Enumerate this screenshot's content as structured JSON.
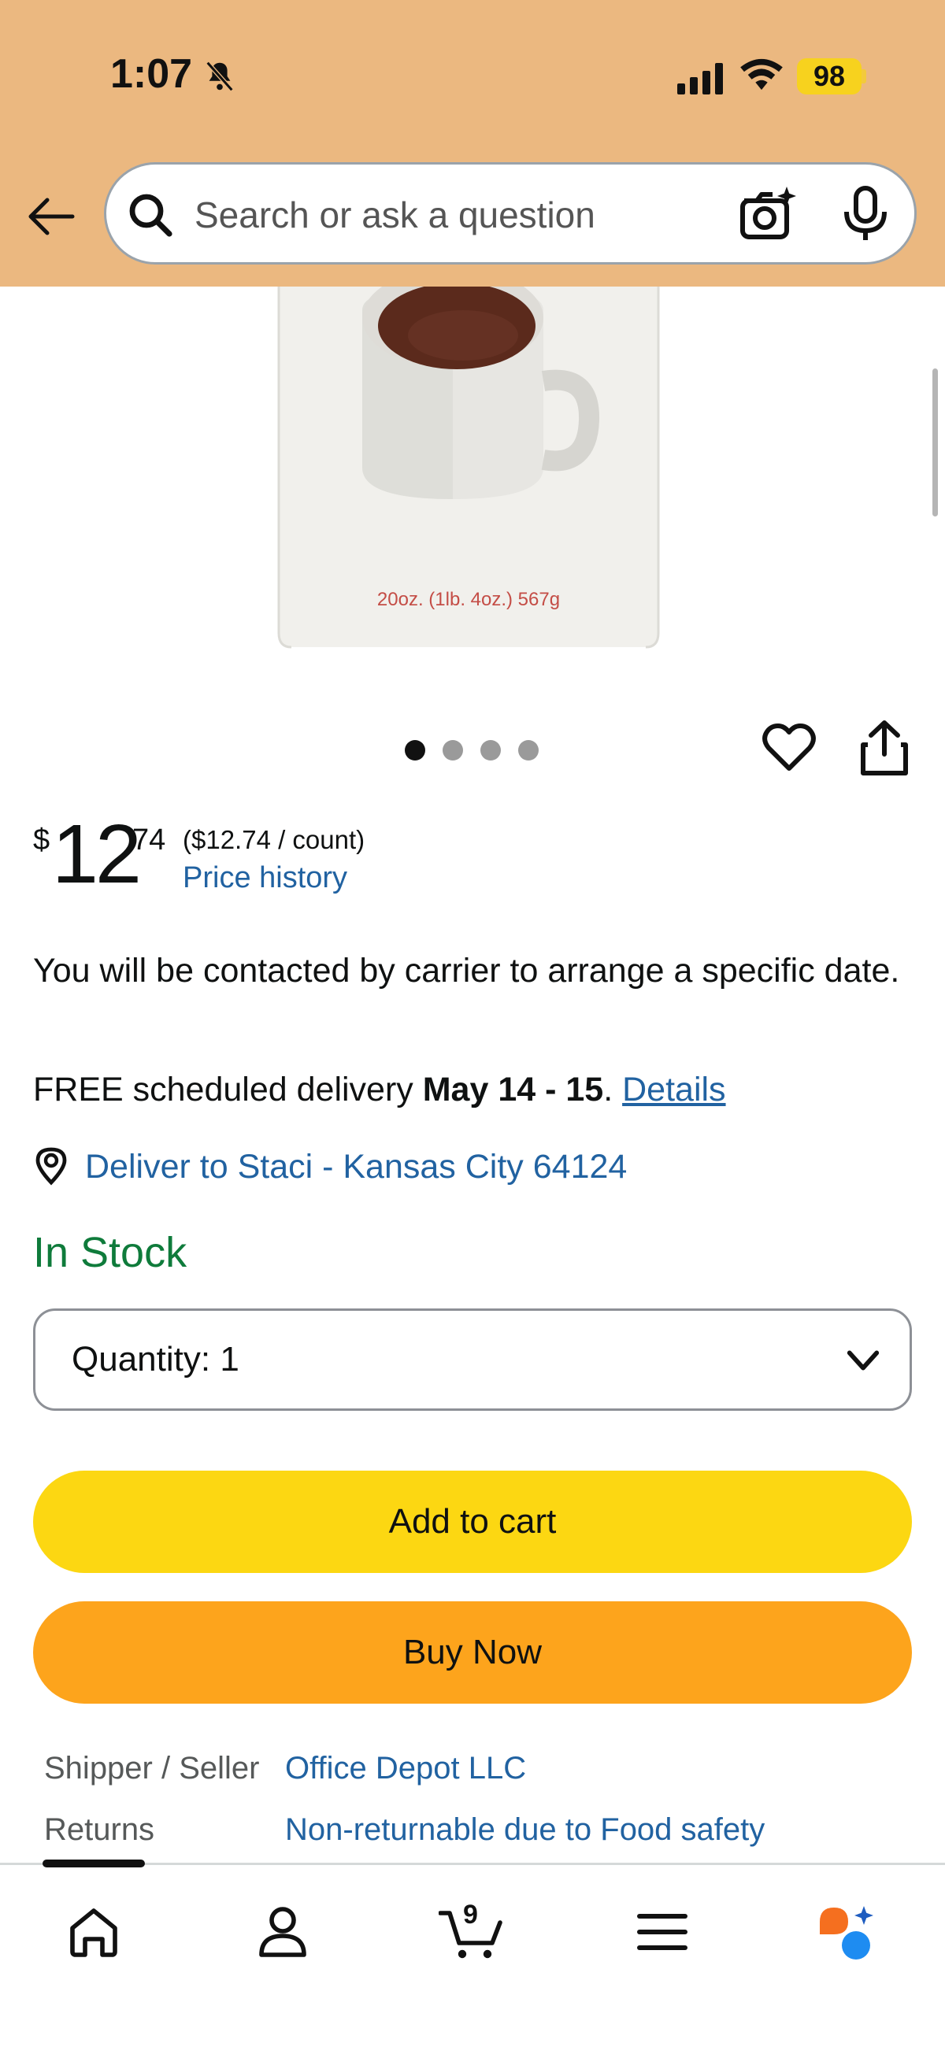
{
  "status_bar": {
    "time": "1:07",
    "battery": "98"
  },
  "search": {
    "placeholder": "Search or ask a question"
  },
  "product": {
    "image_label": "20oz. (1lb. 4oz.) 567g",
    "image_count": 4,
    "active_image_index": 0
  },
  "price": {
    "symbol": "$",
    "whole": "12",
    "fraction": "74",
    "unit_price": "($12.74 / count)",
    "history_link": "Price history"
  },
  "delivery": {
    "carrier_note": "You will be contacted by carrier to arrange a specific date.",
    "prefix": "FREE scheduled delivery ",
    "dates": "May 14 - 15",
    "period": ".",
    "details_link": "Details",
    "deliver_to": "Deliver to Staci - Kansas City 64124"
  },
  "stock": {
    "status": "In Stock"
  },
  "quantity": {
    "label": "Quantity:",
    "value": "1"
  },
  "actions": {
    "add_to_cart": "Add to cart",
    "buy_now": "Buy Now"
  },
  "info": [
    {
      "label": "Shipper / Seller",
      "value": "Office Depot LLC"
    },
    {
      "label": "Returns",
      "value": "Non-returnable due to Food safety"
    }
  ],
  "nav": {
    "cart_count": "9",
    "items": [
      "home-icon",
      "account-icon",
      "cart-icon",
      "menu-icon",
      "rufus-icon"
    ]
  },
  "colors": {
    "header_bg": "#ebb880",
    "link": "#2162a1",
    "in_stock": "#0f7b3b",
    "add_to_cart": "#fcd712",
    "buy_now": "#fda41c"
  }
}
